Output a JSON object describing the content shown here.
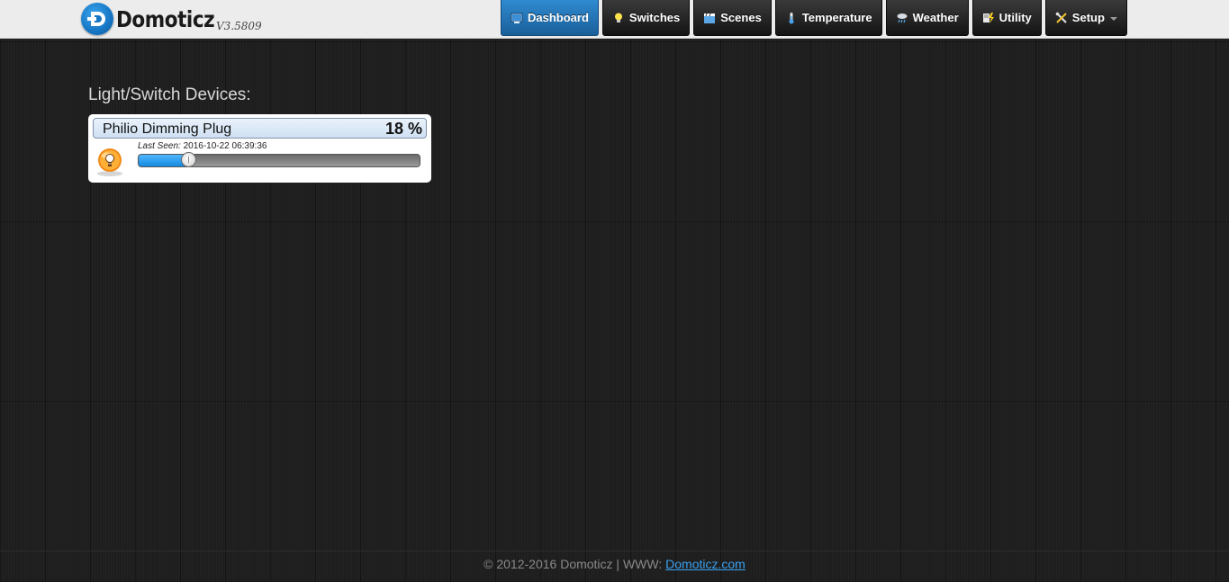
{
  "header": {
    "brand_name": "Domoticz",
    "brand_version": "V3.5809",
    "nav": [
      {
        "label": "Dashboard",
        "icon": "dashboard-icon",
        "active": true
      },
      {
        "label": "Switches",
        "icon": "lightbulb-icon"
      },
      {
        "label": "Scenes",
        "icon": "clapperboard-icon"
      },
      {
        "label": "Temperature",
        "icon": "thermometer-icon"
      },
      {
        "label": "Weather",
        "icon": "rain-cloud-icon"
      },
      {
        "label": "Utility",
        "icon": "utility-icon"
      },
      {
        "label": "Setup",
        "icon": "tools-icon",
        "dropdown": true
      }
    ]
  },
  "main": {
    "section_title": "Light/Switch Devices:",
    "devices": [
      {
        "name": "Philio Dimming Plug",
        "level_text": "18 %",
        "level_fraction": 0.18,
        "last_seen_label": "Last Seen:",
        "last_seen_value": "2016-10-22 06:39:36",
        "icon": "lightbulb-icon"
      }
    ]
  },
  "footer": {
    "text": "© 2012-2016 Domoticz | WWW:",
    "link_text": "Domoticz.com"
  },
  "colors": {
    "accent": "#1a5f99",
    "slider_fill": "#1589e0",
    "link": "#3aa0ef"
  }
}
